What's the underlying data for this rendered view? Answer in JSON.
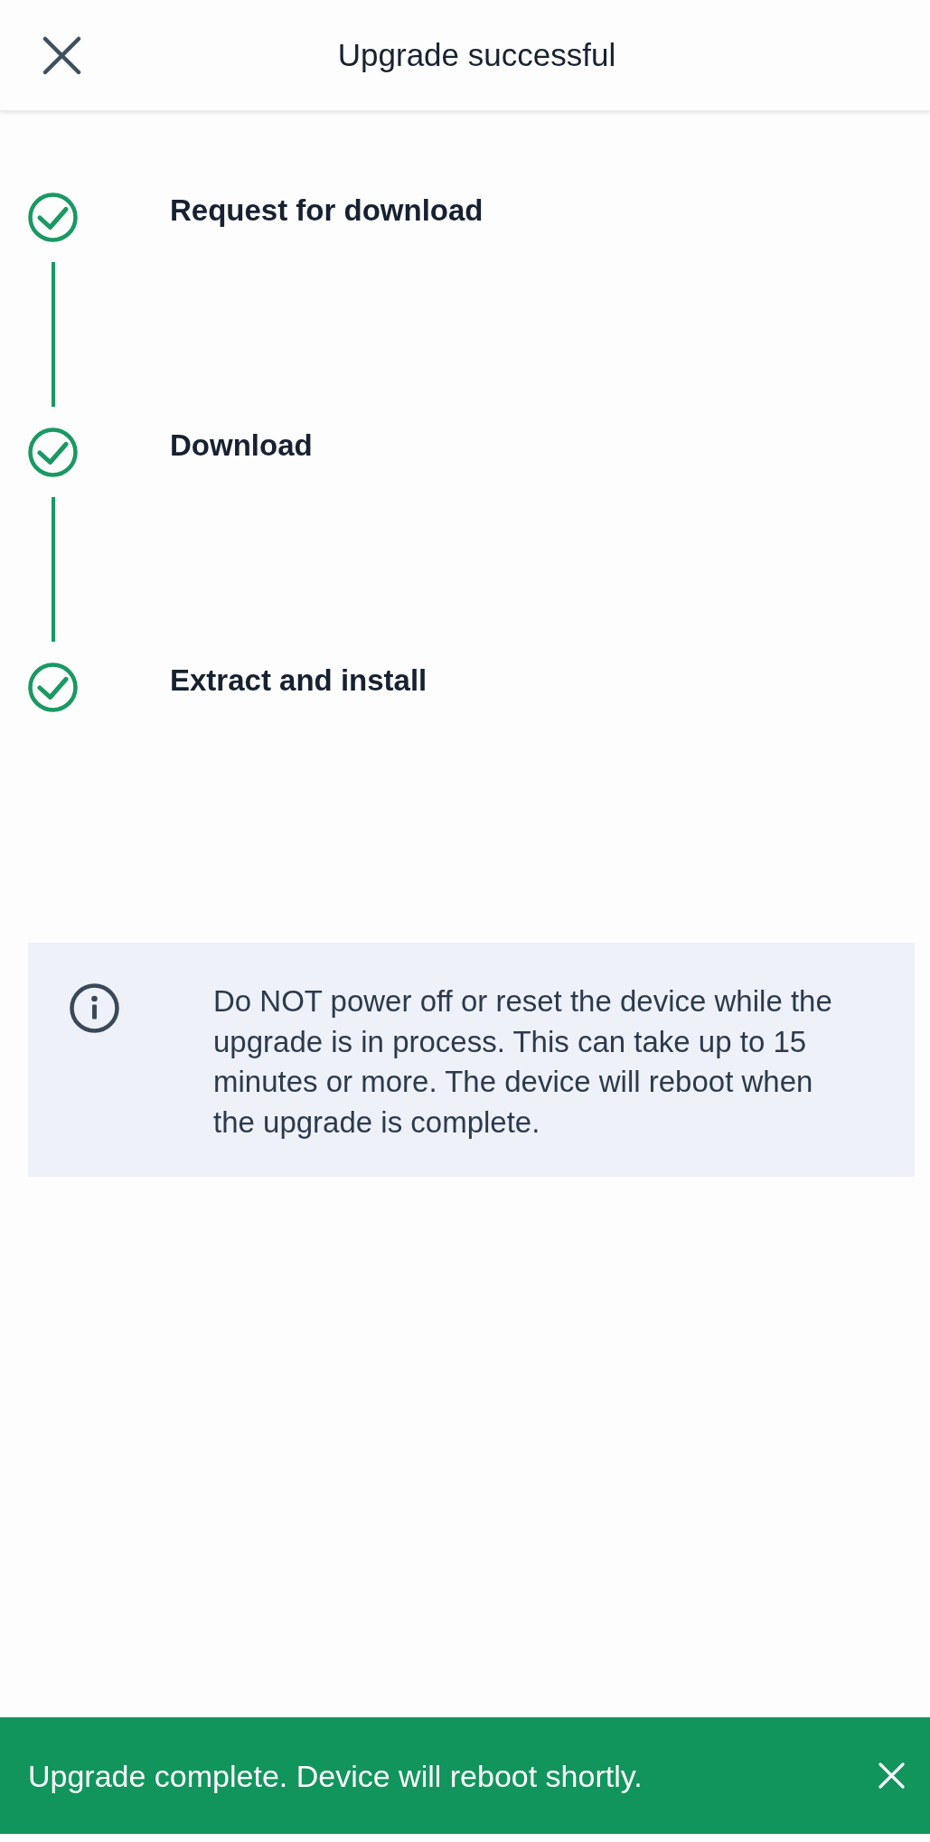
{
  "header": {
    "title": "Upgrade successful"
  },
  "steps": [
    {
      "label": "Request for download",
      "completed": true
    },
    {
      "label": "Download",
      "completed": true
    },
    {
      "label": "Extract and install",
      "completed": true
    }
  ],
  "notice": {
    "text": "Do NOT power off or reset the device while the upgrade is in process. This can take up to 15 minutes or more. The device will reboot when the upgrade is complete."
  },
  "toast": {
    "message": "Upgrade complete. Device will reboot shortly."
  }
}
